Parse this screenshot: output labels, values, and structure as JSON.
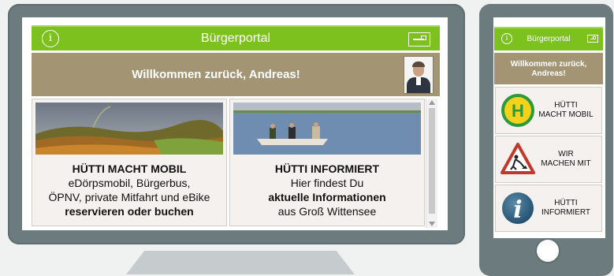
{
  "desktop": {
    "header": {
      "title": "Bürgerportal",
      "info_icon": "info-icon",
      "mail_icon": "mail-icon",
      "accent": "#7dc11f"
    },
    "welcome": {
      "text": "Willkommen zurück, Andreas!",
      "background": "#a39474"
    },
    "cards": [
      {
        "title": "HÜTTI MACHT MOBIL",
        "line1": "eDörpsmobil, Bürgerbus,",
        "line2": "ÖPNV, private Mitfahrt und eBike",
        "bold_line": "reservieren oder buchen"
      },
      {
        "title": "HÜTTI INFORMIERT",
        "line1": "Hier findest Du",
        "bold_line": "aktuelle Informationen",
        "line3": "aus Groß Wittensee"
      }
    ]
  },
  "phone": {
    "header": {
      "title": "Bürgerportal"
    },
    "welcome": {
      "line1": "Willkommen zurück,",
      "line2": "Andreas!"
    },
    "tiles": [
      {
        "line1": "HÜTTI",
        "line2": "MACHT MOBIL",
        "icon": "bus-stop-icon"
      },
      {
        "line1": "WIR",
        "line2": "MACHEN MIT",
        "icon": "construction-sign-icon"
      },
      {
        "line1": "HÜTTI",
        "line2": "INFORMIERT",
        "icon": "info-icon"
      }
    ]
  }
}
